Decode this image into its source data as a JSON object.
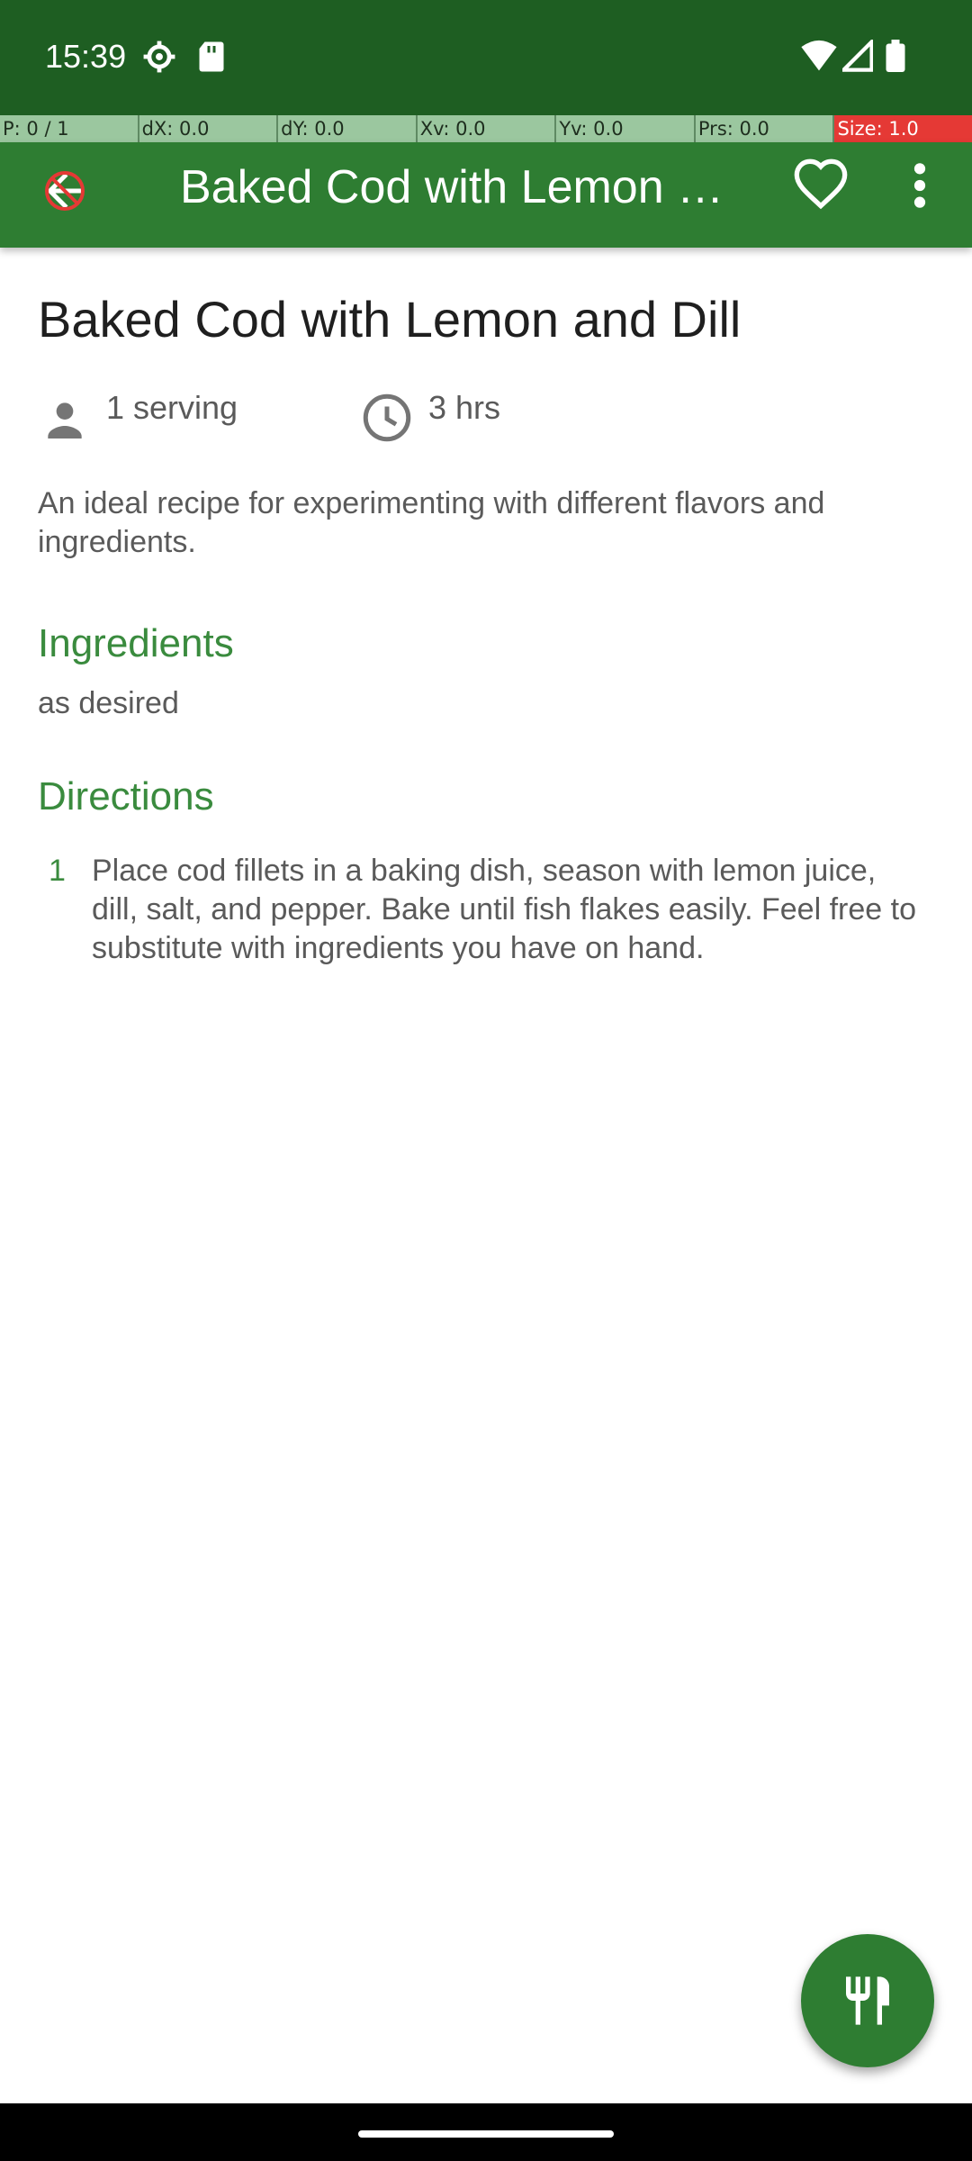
{
  "status_bar": {
    "time": "15:39",
    "icons": [
      "settings-icon",
      "sd-card-icon",
      "wifi-icon",
      "cell-signal-icon",
      "battery-icon"
    ]
  },
  "pointer_overlay": {
    "cells": [
      "P: 0 / 1",
      "dX: 0.0",
      "dY: 0.0",
      "Xv: 0.0",
      "Yv: 0.0",
      "Prs: 0.0",
      "Size: 1.0"
    ]
  },
  "app_bar": {
    "title": "Baked Cod with Lemon and Dill",
    "nav_icon": "back-arrow-icon",
    "favorite_icon": "heart-outline-icon",
    "more_icon": "more-vert-icon"
  },
  "recipe": {
    "title": "Baked Cod with Lemon and Dill",
    "servings": "1 serving",
    "time": "3 hrs",
    "description": "An ideal recipe for experimenting with different flavors and ingredients.",
    "ingredients_heading": "Ingredients",
    "ingredients": [
      "as desired"
    ],
    "directions_heading": "Directions",
    "directions": [
      {
        "number": "1",
        "text": "Place cod fillets in a baking dish, season with lemon juice, dill, salt, and pepper. Bake until fish flakes easily. Feel free to substitute with ingredients you have on hand."
      }
    ]
  },
  "fab": {
    "icon": "fork-knife-icon"
  },
  "colors": {
    "status_bar": "#1e5e22",
    "app_bar": "#2e7d32",
    "accent": "#3a8b3e",
    "text_secondary": "#5a5a5a"
  }
}
